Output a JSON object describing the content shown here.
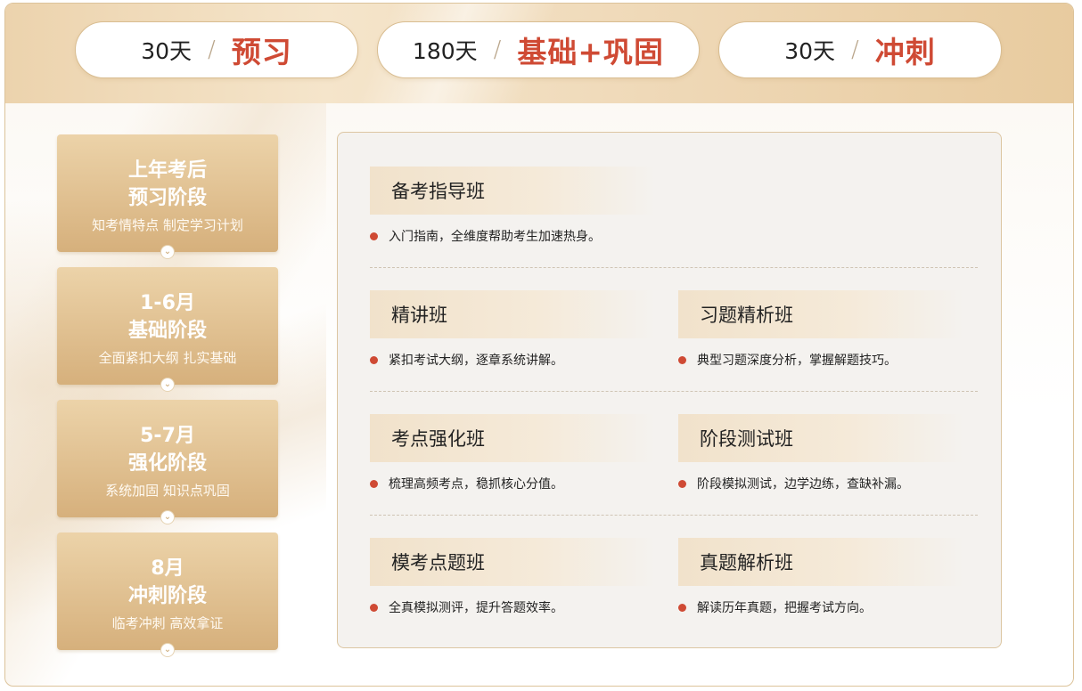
{
  "phases": [
    {
      "days": "30天",
      "slash": "/",
      "name": "预习"
    },
    {
      "days": "180天",
      "slash": "/",
      "name": "基础+巩固"
    },
    {
      "days": "30天",
      "slash": "/",
      "name": "冲刺"
    }
  ],
  "stages": [
    {
      "line1": "上年考后",
      "line2": "预习阶段",
      "desc": "知考情特点 制定学习计划"
    },
    {
      "line1": "1-6月",
      "line2": "基础阶段",
      "desc": "全面紧扣大纲 扎实基础"
    },
    {
      "line1": "5-7月",
      "line2": "强化阶段",
      "desc": "系统加固 知识点巩固"
    },
    {
      "line1": "8月",
      "line2": "冲刺阶段",
      "desc": "临考冲刺 高效拿证"
    }
  ],
  "courses": [
    {
      "name": "备考指导班",
      "desc": "入门指南，全维度帮助考生加速热身。"
    },
    {
      "name": "精讲班",
      "desc": "紧扣考试大纲，逐章系统讲解。"
    },
    {
      "name": "习题精析班",
      "desc": "典型习题深度分析，掌握解题技巧。"
    },
    {
      "name": "考点强化班",
      "desc": "梳理高频考点，稳抓核心分值。"
    },
    {
      "name": "阶段测试班",
      "desc": "阶段模拟测试，边学边练，查缺补漏。"
    },
    {
      "name": "模考点题班",
      "desc": "全真模拟测评，提升答题效率。"
    },
    {
      "name": "真题解析班",
      "desc": "解读历年真题，把握考试方向。"
    }
  ],
  "icons": {
    "stage_expand": "chevron-down-icon",
    "bullet": "bullet-dot-icon"
  },
  "colors": {
    "accent": "#cf4a34",
    "gold": "#d6b07c",
    "panel_bg": "#f4f2ef"
  }
}
